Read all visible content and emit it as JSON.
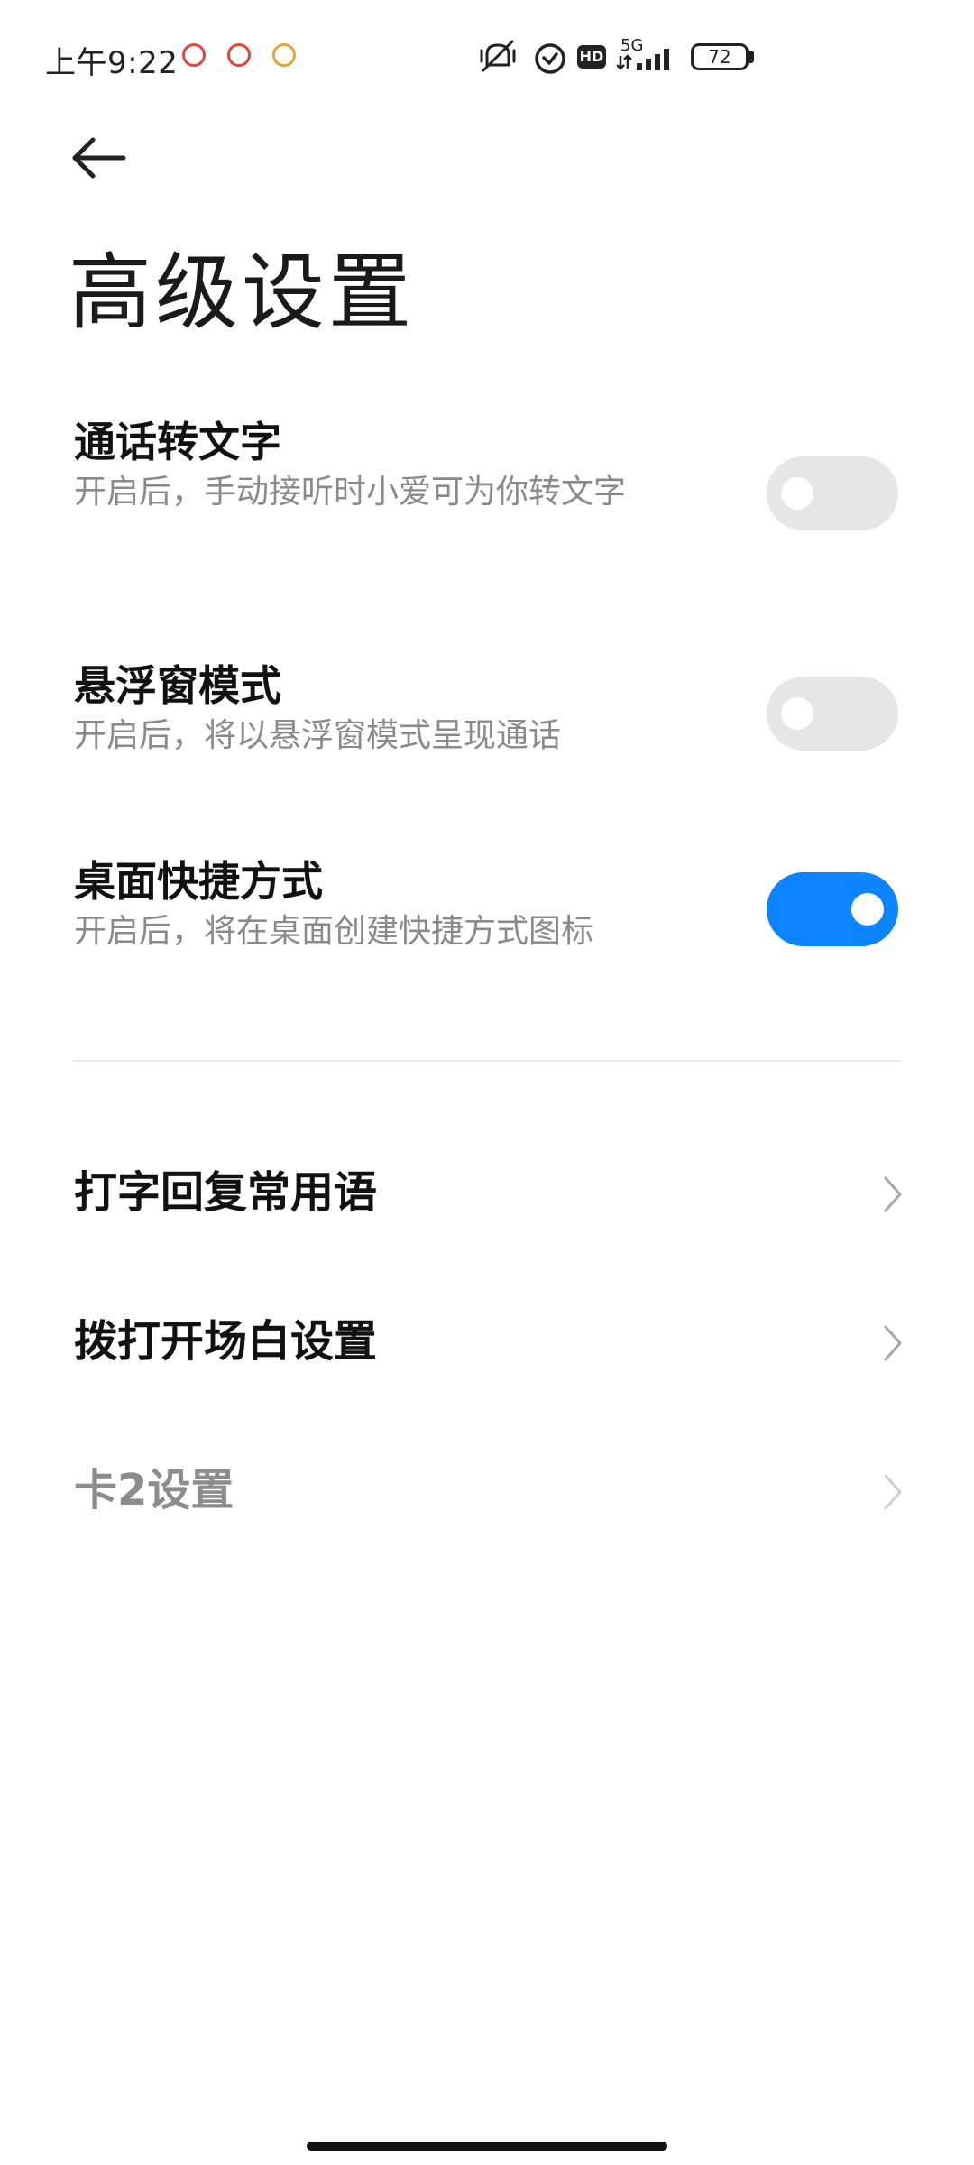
{
  "status_bar": {
    "time": "上午9:22",
    "network": "5G",
    "hd_badge": "HD",
    "battery": "72",
    "notification_icons": [
      "app-notification-icon",
      "app-notification-icon",
      "app-notification-icon"
    ],
    "icons": [
      "mute-vibrate-icon",
      "alarm-icon",
      "hd-icon",
      "signal-icon",
      "battery-icon"
    ]
  },
  "header": {
    "back_icon": "back-arrow-icon",
    "title": "高级设置"
  },
  "toggles": [
    {
      "title": "通话转文字",
      "description": "开启后，手动接听时小爱可为你转文字",
      "enabled": false
    },
    {
      "title": "悬浮窗模式",
      "description": "开启后，将以悬浮窗模式呈现通话",
      "enabled": false
    },
    {
      "title": "桌面快捷方式",
      "description": "开启后，将在桌面创建快捷方式图标",
      "enabled": true
    }
  ],
  "nav_items": [
    {
      "label": "打字回复常用语",
      "enabled": true
    },
    {
      "label": "拨打开场白设置",
      "enabled": true
    },
    {
      "label": "卡2设置",
      "enabled": false
    }
  ],
  "colors": {
    "accent": "#0d84ff",
    "toggle_off": "#e6e6e6",
    "secondary_text": "#8a8a8a"
  }
}
